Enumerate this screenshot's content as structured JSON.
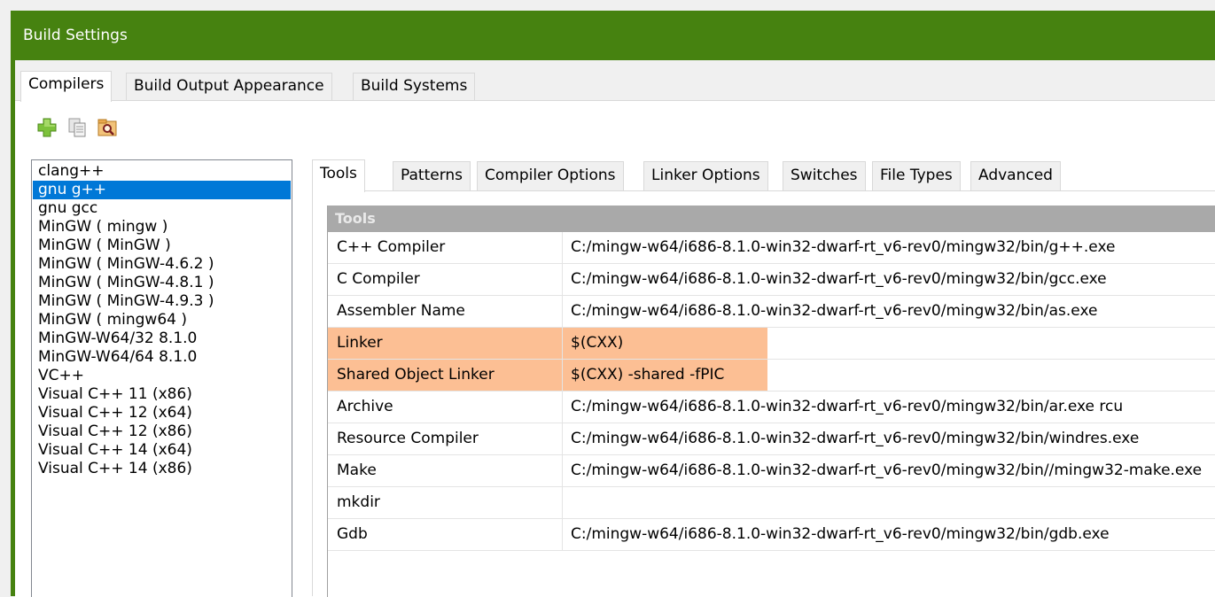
{
  "window": {
    "title": "Build Settings"
  },
  "outer_tabs": [
    {
      "label": "Compilers",
      "active": true
    },
    {
      "label": "Build Output Appearance",
      "active": false
    },
    {
      "label": "Build Systems",
      "active": false
    }
  ],
  "toolbar": {
    "buttons": [
      {
        "icon": "add-icon"
      },
      {
        "icon": "copy-icon"
      },
      {
        "icon": "find-icon"
      }
    ]
  },
  "compilers": [
    "clang++",
    "gnu g++",
    "gnu gcc",
    "MinGW ( mingw )",
    "MinGW ( MinGW )",
    "MinGW ( MinGW-4.6.2 )",
    "MinGW ( MinGW-4.8.1 )",
    "MinGW ( MinGW-4.9.3 )",
    "MinGW ( mingw64 )",
    "MinGW-W64/32 8.1.0",
    "MinGW-W64/64 8.1.0",
    "VC++",
    "Visual C++ 11 (x86)",
    "Visual C++ 12 (x64)",
    "Visual C++ 12 (x86)",
    "Visual C++ 14 (x64)",
    "Visual C++ 14 (x86)"
  ],
  "selected_compiler": "gnu g++",
  "inner_tabs": [
    {
      "label": "Tools",
      "active": true
    },
    {
      "label": "Patterns",
      "active": false
    },
    {
      "label": "Compiler Options",
      "active": false
    },
    {
      "label": "Linker Options",
      "active": false
    },
    {
      "label": "Switches",
      "active": false
    },
    {
      "label": "File Types",
      "active": false
    },
    {
      "label": "Advanced",
      "active": false
    }
  ],
  "tools": {
    "header": "Tools",
    "rows": [
      {
        "name": "C++ Compiler",
        "value": "C:/mingw-w64/i686-8.1.0-win32-dwarf-rt_v6-rev0/mingw32/bin/g++.exe",
        "highlight": false
      },
      {
        "name": "C Compiler",
        "value": "C:/mingw-w64/i686-8.1.0-win32-dwarf-rt_v6-rev0/mingw32/bin/gcc.exe",
        "highlight": false
      },
      {
        "name": "Assembler Name",
        "value": "C:/mingw-w64/i686-8.1.0-win32-dwarf-rt_v6-rev0/mingw32/bin/as.exe",
        "highlight": false
      },
      {
        "name": "Linker",
        "value": "$(CXX)",
        "highlight": true
      },
      {
        "name": "Shared Object Linker",
        "value": "$(CXX) -shared -fPIC",
        "highlight": true
      },
      {
        "name": "Archive",
        "value": "C:/mingw-w64/i686-8.1.0-win32-dwarf-rt_v6-rev0/mingw32/bin/ar.exe rcu",
        "highlight": false
      },
      {
        "name": "Resource Compiler",
        "value": "C:/mingw-w64/i686-8.1.0-win32-dwarf-rt_v6-rev0/mingw32/bin/windres.exe",
        "highlight": false
      },
      {
        "name": "Make",
        "value": "C:/mingw-w64/i686-8.1.0-win32-dwarf-rt_v6-rev0/mingw32/bin//mingw32-make.exe",
        "highlight": false
      },
      {
        "name": "mkdir",
        "value": "",
        "highlight": false
      },
      {
        "name": "Gdb",
        "value": "C:/mingw-w64/i686-8.1.0-win32-dwarf-rt_v6-rev0/mingw32/bin/gdb.exe",
        "highlight": false
      }
    ]
  },
  "colors": {
    "titlebar": "#468210",
    "selection": "#0078d7",
    "highlight": "#fcbf94",
    "grid_header": "#a9a9a9"
  }
}
